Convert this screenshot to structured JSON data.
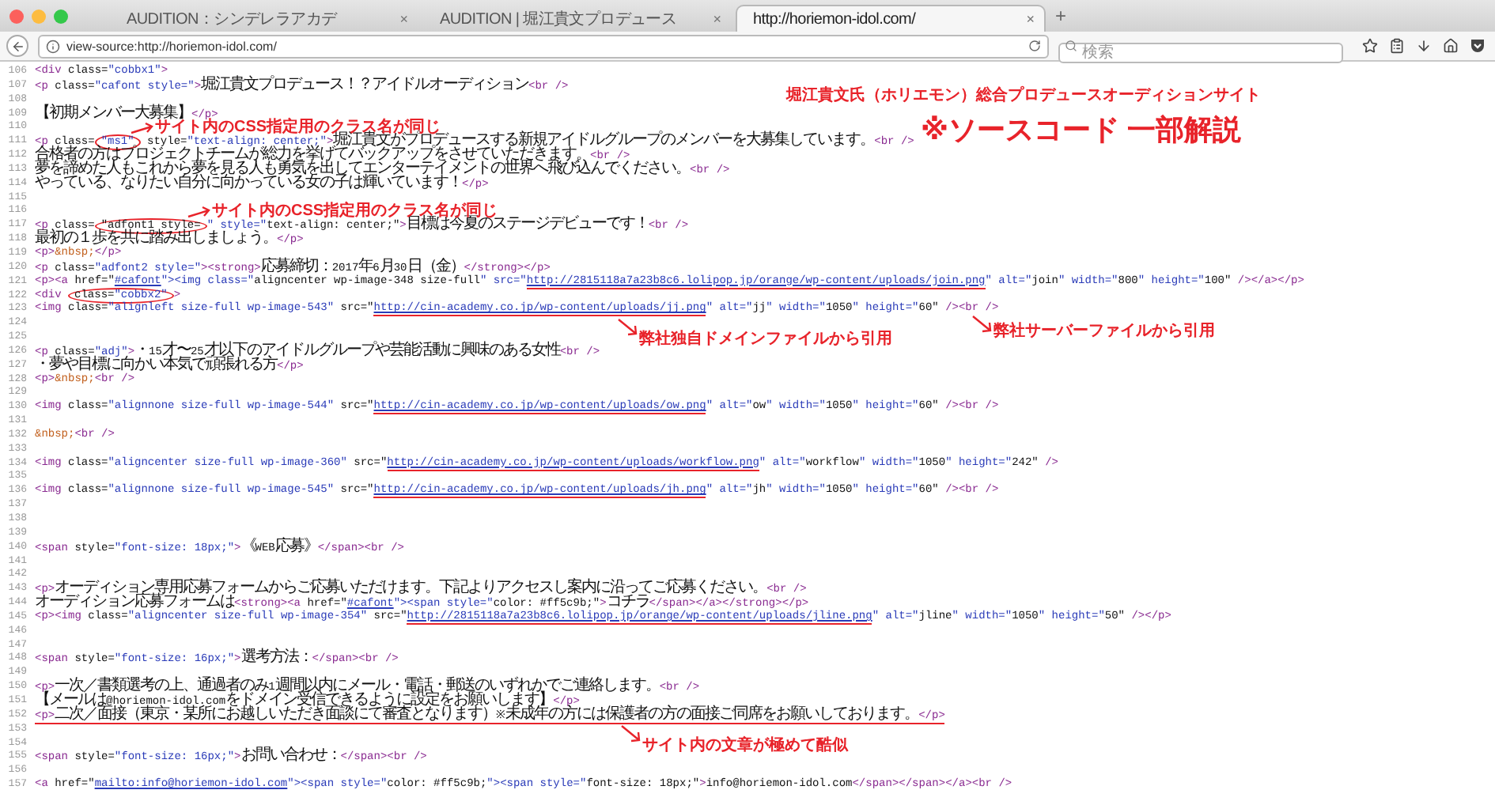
{
  "browser": {
    "tabs": [
      {
        "label": "AUDITION：シンデレラアカデ",
        "selected": false
      },
      {
        "label": "AUDITION | 堀江貴文プロデュース",
        "selected": false
      },
      {
        "label": "http://horiemon-idol.com/",
        "selected": true
      }
    ],
    "new_tab": "+",
    "close": "×",
    "address": "view-source:http://horiemon-idol.com/",
    "search": {
      "placeholder": "検索"
    }
  },
  "heading": {
    "title": "堀江貴文氏（ホリエモン）総合プロデュースオーディションサイト",
    "subtitle": "※ソースコード 一部解説"
  },
  "annotations": [
    {
      "text": "サイト内のCSS指定用のクラス名が同じ"
    },
    {
      "text": "サイト内のCSS指定用のクラス名が同じ"
    },
    {
      "text": "弊社サーバーファイルから引用"
    },
    {
      "text": "弊社独自ドメインファイルから引用"
    },
    {
      "text": "サイト内の文章が極めて酷似"
    }
  ],
  "source_lines": [
    {
      "n": "106",
      "parts": [
        "<div class=\"cobbx1\">"
      ]
    },
    {
      "n": "107",
      "parts": [
        "<p class=\"cafont style=\">堀江貴文プロデュース！？アイドルオーディション<br />"
      ]
    },
    {
      "n": "108"
    },
    {
      "n": "109",
      "parts": [
        "【初期メンバー大募集】</p>"
      ]
    },
    {
      "n": "110"
    },
    {
      "n": "111",
      "parts": [
        "<p class=",
        {
          "kind": "circled",
          "text": "\"ms1\""
        },
        " style=\"text-align: center;\">堀江貴文がプロデュースする新規アイドルグループのメンバーを大募集しています。<br />"
      ]
    },
    {
      "n": "112",
      "parts": [
        "合格者の方はプロジェクトチームが総力を挙げてバックアップをさせていただきます。<br />"
      ]
    },
    {
      "n": "113",
      "parts": [
        "夢を諦めた人もこれから夢を見る人も勇気を出してエンターテイメントの世界へ飛び込んでください。<br />"
      ]
    },
    {
      "n": "114",
      "parts": [
        "やっている、なりたい自分に向かっている女の子は輝いています！</p>"
      ]
    },
    {
      "n": "115"
    },
    {
      "n": "116"
    },
    {
      "n": "117",
      "parts": [
        "<p class=",
        {
          "kind": "circled",
          "text": "\"adfont1 style="
        },
        "\" style=\"text-align: center;\">目標は今夏のステージデビューです！<br />"
      ]
    },
    {
      "n": "118",
      "parts": [
        "最初の１歩を共に踏み出しましょう。</p>"
      ]
    },
    {
      "n": "119",
      "parts": [
        "<p>&nbsp;</p>"
      ]
    },
    {
      "n": "120",
      "parts": [
        "<p class=\"adfont2 style=\"><strong>応募締切：2017年6月30日（金）</strong></p>"
      ]
    },
    {
      "n": "121",
      "parts": [
        "<p><a href=\"",
        {
          "kind": "link",
          "text": "#cafont",
          "underlined": false
        },
        "\"><img class=\"aligncenter wp-image-348 size-full\" src=\"",
        {
          "kind": "link",
          "text": "http://2815118a7a23b8c6.lolipop.jp/orange/wp-content/uploads/join.png",
          "underlined": true
        },
        "\" alt=\"join\" width=\"800\" height=\"100\" /></a></p>"
      ]
    },
    {
      "n": "122",
      "parts": [
        "<div ",
        {
          "kind": "circled",
          "text": "class=\"cobbx2\""
        },
        ">"
      ]
    },
    {
      "n": "123",
      "parts": [
        "<img class=\"alignleft size-full wp-image-543\" src=\"",
        {
          "kind": "link",
          "text": "http://cin-academy.co.jp/wp-content/uploads/jj.png",
          "underlined": true
        },
        "\" alt=\"jj\" width=\"1050\" height=\"60\" /><br />"
      ]
    },
    {
      "n": "124"
    },
    {
      "n": "125"
    },
    {
      "n": "126",
      "parts": [
        "<p class=\"adj\">・15才〜25才以下のアイドルグループや芸能活動に興味のある女性<br />"
      ]
    },
    {
      "n": "127",
      "parts": [
        "・夢や目標に向かい本気で頑張れる方</p>"
      ]
    },
    {
      "n": "128",
      "parts": [
        "<p>&nbsp;<br />"
      ]
    },
    {
      "n": "129"
    },
    {
      "n": "130",
      "parts": [
        "<img class=\"alignnone size-full wp-image-544\" src=\"",
        {
          "kind": "link",
          "text": "http://cin-academy.co.jp/wp-content/uploads/ow.png",
          "underlined": true
        },
        "\" alt=\"ow\" width=\"1050\" height=\"60\" /><br />"
      ]
    },
    {
      "n": "131"
    },
    {
      "n": "132",
      "parts": [
        "&nbsp;<br />"
      ]
    },
    {
      "n": "133"
    },
    {
      "n": "134",
      "parts": [
        "<img class=\"aligncenter size-full wp-image-360\" src=\"",
        {
          "kind": "link",
          "text": "http://cin-academy.co.jp/wp-content/uploads/workflow.png",
          "underlined": true
        },
        "\" alt=\"workflow\" width=\"1050\" height=\"242\" />"
      ]
    },
    {
      "n": "135"
    },
    {
      "n": "136",
      "parts": [
        "<img class=\"alignnone size-full wp-image-545\" src=\"",
        {
          "kind": "link",
          "text": "http://cin-academy.co.jp/wp-content/uploads/jh.png",
          "underlined": true
        },
        "\" alt=\"jh\" width=\"1050\" height=\"60\" /><br />"
      ]
    },
    {
      "n": "137"
    },
    {
      "n": "138"
    },
    {
      "n": "139"
    },
    {
      "n": "140",
      "parts": [
        "<span style=\"font-size: 18px;\">《WEB応募》</span><br />"
      ]
    },
    {
      "n": "141"
    },
    {
      "n": "142"
    },
    {
      "n": "143",
      "parts": [
        "<p>オーディション専用応募フォームからご応募いただけます。下記よりアクセスし案内に沿ってご応募ください。<br />"
      ]
    },
    {
      "n": "144",
      "parts": [
        "オーディション応募フォームは<strong><a href=\"",
        {
          "kind": "link",
          "text": "#cafont",
          "underlined": false
        },
        "\"><span style=\"color: #ff5c9b;\">コチラ</span></a></strong></p>"
      ]
    },
    {
      "n": "145",
      "parts": [
        "<p><img class=\"aligncenter size-full wp-image-354\" src=\"",
        {
          "kind": "link",
          "text": "http://2815118a7a23b8c6.lolipop.jp/orange/wp-content/uploads/jline.png",
          "underlined": true
        },
        "\" alt=\"jline\" width=\"1050\" height=\"50\" /></p>"
      ]
    },
    {
      "n": "146"
    },
    {
      "n": "147"
    },
    {
      "n": "148",
      "parts": [
        "<span style=\"font-size: 16px;\">選考方法：</span><br />"
      ]
    },
    {
      "n": "149"
    },
    {
      "n": "150",
      "parts": [
        "<p>一次／書類選考の上、通過者のみ1週間以内にメール・電話・郵送のいずれかでご連絡します。<br />"
      ]
    },
    {
      "n": "151",
      "parts": [
        "【メールは@horiemon-idol.comをドメイン受信できるように設定をお願いします】</p>"
      ]
    },
    {
      "n": "152",
      "parts": [
        {
          "kind": "marked",
          "text": "<p>二次／面接（東京・某所にお越しいただき面談にて審査となります）※未成年の方には保護者の方の面接ご同席をお願いしております。</p>",
          "underlined": true
        }
      ]
    },
    {
      "n": "153"
    },
    {
      "n": "154"
    },
    {
      "n": "155",
      "parts": [
        "<span style=\"font-size: 16px;\">お問い合わせ：</span><br />"
      ]
    },
    {
      "n": "156"
    },
    {
      "n": "157",
      "parts": [
        "<a href=\"",
        {
          "kind": "link",
          "text": "mailto:info@horiemon-idol.com",
          "underlined": false
        },
        "\"><span style=\"color: #ff5c9b;\"><span style=\"font-size: 18px;\">info@horiemon-idol.com</span></span></a><br />"
      ]
    }
  ]
}
